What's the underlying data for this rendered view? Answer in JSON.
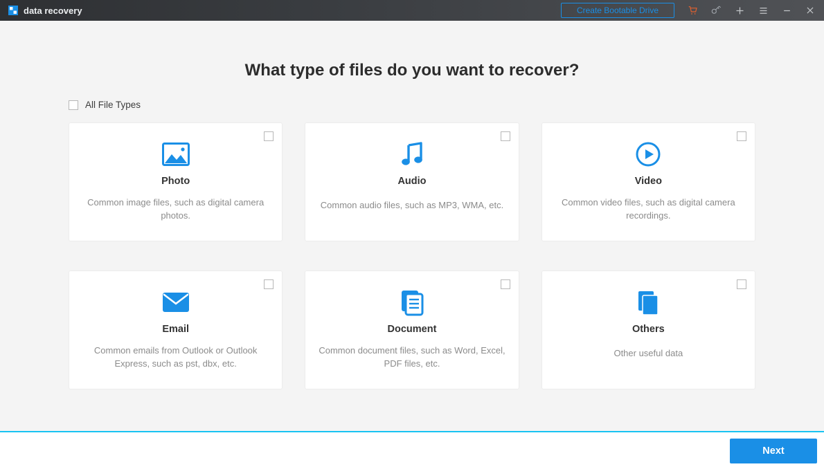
{
  "app": {
    "name": "data recovery"
  },
  "titlebar": {
    "bootable_label": "Create Bootable Drive"
  },
  "headline": "What type of files do you want to recover?",
  "all_types_label": "All File Types",
  "cards": [
    {
      "title": "Photo",
      "desc": "Common image files, such as digital camera photos."
    },
    {
      "title": "Audio",
      "desc": "Common audio files, such as MP3, WMA, etc."
    },
    {
      "title": "Video",
      "desc": "Common video files, such as digital camera recordings."
    },
    {
      "title": "Email",
      "desc": "Common emails from Outlook or Outlook Express, such as pst, dbx, etc."
    },
    {
      "title": "Document",
      "desc": "Common document files, such as Word, Excel, PDF files, etc."
    },
    {
      "title": "Others",
      "desc": "Other useful data"
    }
  ],
  "footer": {
    "next_label": "Next"
  },
  "colors": {
    "accent": "#1a8fe6"
  }
}
